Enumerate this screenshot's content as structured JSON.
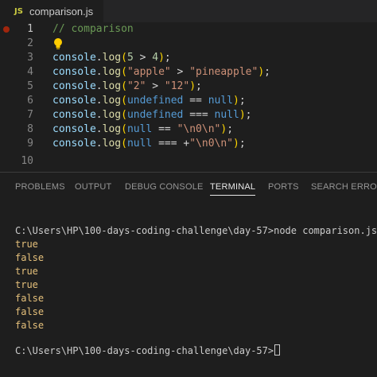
{
  "editor_tab": {
    "icon": "JS",
    "filename": "comparison.js"
  },
  "code": {
    "line_numbers": [
      "1",
      "2",
      "3",
      "4",
      "5",
      "6",
      "7",
      "8",
      "9",
      "10"
    ],
    "line1": {
      "comment": "// comparison"
    },
    "line3": {
      "obj": "console",
      "dot": ".",
      "fn": "log",
      "open": "(",
      "a": "5",
      "op": " > ",
      "b": "4",
      "close": ")",
      "semi": ";"
    },
    "line4": {
      "obj": "console",
      "dot": ".",
      "fn": "log",
      "open": "(",
      "a": "\"apple\"",
      "op": " > ",
      "b": "\"pineapple\"",
      "close": ")",
      "semi": ";"
    },
    "line5": {
      "obj": "console",
      "dot": ".",
      "fn": "log",
      "open": "(",
      "a": "\"2\"",
      "op": " > ",
      "b": "\"12\"",
      "close": ")",
      "semi": ";"
    },
    "line6": {
      "obj": "console",
      "dot": ".",
      "fn": "log",
      "open": "(",
      "a": "undefined",
      "op": " == ",
      "b": "null",
      "close": ")",
      "semi": ";"
    },
    "line7": {
      "obj": "console",
      "dot": ".",
      "fn": "log",
      "open": "(",
      "a": "undefined",
      "op": " === ",
      "b": "null",
      "close": ")",
      "semi": ";"
    },
    "line8": {
      "obj": "console",
      "dot": ".",
      "fn": "log",
      "open": "(",
      "a": "null",
      "op": " == ",
      "b": "\"\\n0\\n\"",
      "close": ")",
      "semi": ";"
    },
    "line9": {
      "obj": "console",
      "dot": ".",
      "fn": "log",
      "open": "(",
      "a": "null",
      "op": " === +",
      "b": "\"\\n0\\n\"",
      "close": ")",
      "semi": ";"
    }
  },
  "panel": {
    "tabs": [
      "PROBLEMS",
      "OUTPUT",
      "DEBUG CONSOLE",
      "TERMINAL",
      "PORTS",
      "SEARCH ERROR"
    ],
    "active_tab": "TERMINAL"
  },
  "terminal": {
    "command_line": "C:\\Users\\HP\\100-days-coding-challenge\\day-57>node comparison.js",
    "output": [
      "true",
      "false",
      "true",
      "true",
      "false",
      "false",
      "false"
    ],
    "prompt": "C:\\Users\\HP\\100-days-coding-challenge\\day-57>"
  },
  "colors": {
    "editor_bg": "#1e1e1e",
    "keyword": "#569cd6",
    "string": "#ce9178",
    "function": "#dcdcaa",
    "variable": "#9cdcfe",
    "comment": "#6a9955",
    "terminal_output": "#e5c07b"
  },
  "icons": {
    "breakpoint": "breakpoint-dot-icon",
    "lightbulb": "lightbulb-icon",
    "file_type": "javascript-file-icon"
  }
}
